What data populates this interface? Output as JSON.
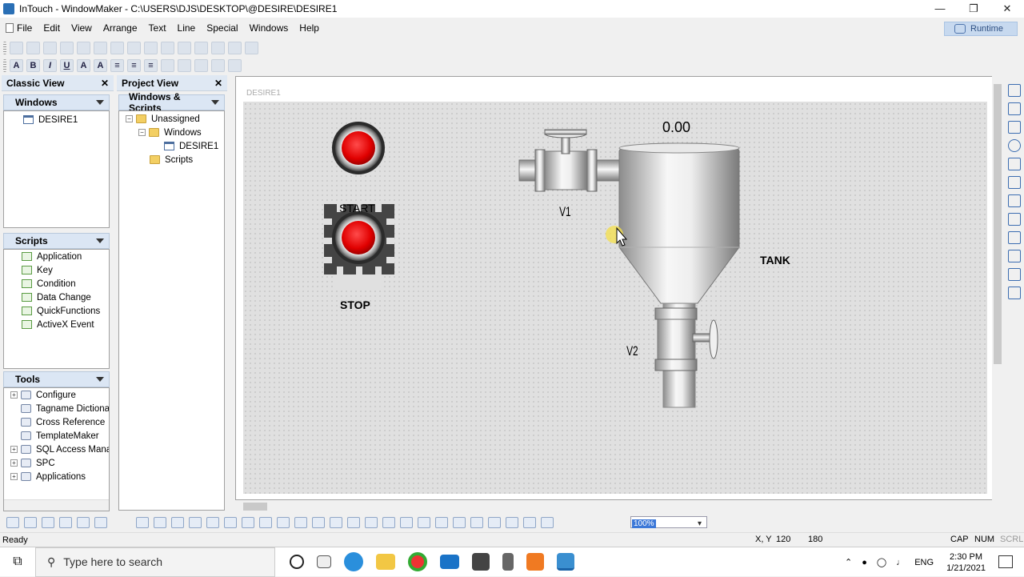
{
  "window": {
    "title": "InTouch - WindowMaker - C:\\USERS\\DJS\\DESKTOP\\@DESIRE\\DESIRE1"
  },
  "menu": [
    "File",
    "Edit",
    "View",
    "Arrange",
    "Text",
    "Line",
    "Special",
    "Windows",
    "Help"
  ],
  "runtime_label": "Runtime",
  "classic_view": {
    "title": "Classic View",
    "windows_section": "Windows",
    "windows_items": [
      "DESIRE1"
    ],
    "scripts_section": "Scripts",
    "scripts_items": [
      "Application",
      "Key",
      "Condition",
      "Data Change",
      "QuickFunctions",
      "ActiveX Event"
    ],
    "tools_section": "Tools",
    "tools_items": [
      "Configure",
      "Tagname Dictiona",
      "Cross Reference",
      "TemplateMaker",
      "SQL Access Mana",
      "SPC",
      "Applications"
    ]
  },
  "project_view": {
    "title": "Project View",
    "section": "Windows & Scripts",
    "tree": [
      "Unassigned",
      "Windows",
      "DESIRE1",
      "Scripts"
    ]
  },
  "canvas": {
    "window_name": "DESIRE1",
    "start_label": "START",
    "stop_label": "STOP",
    "valve1_label": "V1",
    "valve2_label": "V2",
    "tank_label": "TANK",
    "level_value": "0.00"
  },
  "zoom": "100%",
  "status": {
    "ready": "Ready",
    "xy_label": "X, Y",
    "x": "120",
    "y": "180",
    "cap": "CAP",
    "num": "NUM",
    "scrl": "SCRL"
  },
  "taskbar": {
    "search_placeholder": "Type here to search",
    "lang": "ENG",
    "time": "2:30 PM",
    "date": "1/21/2021"
  }
}
